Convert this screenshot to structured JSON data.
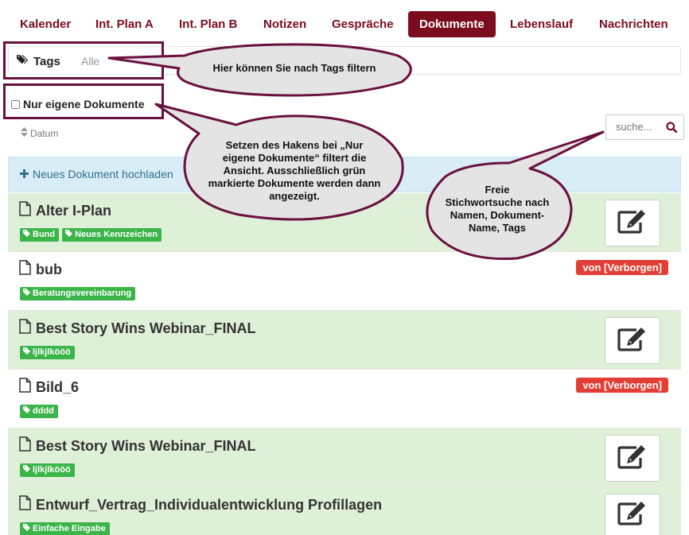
{
  "nav": {
    "items": [
      {
        "label": "Kalender"
      },
      {
        "label": "Int. Plan A"
      },
      {
        "label": "Int. Plan B"
      },
      {
        "label": "Notizen"
      },
      {
        "label": "Gespräche"
      },
      {
        "label": "Dokumente",
        "active": true
      },
      {
        "label": "Lebenslauf"
      },
      {
        "label": "Nachrichten"
      }
    ]
  },
  "filters": {
    "tags_label": "Tags",
    "tags_all": "Alle",
    "own_docs_label": "Nur eigene Dokumente",
    "own_docs_checked": false,
    "sort_label": "Datum",
    "search_placeholder": "suche..."
  },
  "upload": {
    "label": "Neues Dokument hochladen"
  },
  "documents": [
    {
      "title": "Alter I-Plan",
      "tags": [
        "Bund",
        "Neues Kennzeichen"
      ],
      "editable": true
    },
    {
      "title": "bub",
      "tags": [
        "Beratungsvereinbarung"
      ],
      "badge": "von [Verborgen]"
    },
    {
      "title": "Best Story Wins Webinar_FINAL",
      "tags": [
        "ljlkjlkööö"
      ],
      "editable": true
    },
    {
      "title": "Bild_6",
      "tags": [
        "dddd"
      ],
      "badge": "von [Verborgen]"
    },
    {
      "title": "Best Story Wins Webinar_FINAL",
      "tags": [
        "ljlkjlkööö"
      ],
      "editable": true
    },
    {
      "title": "Entwurf_Vertrag_Individualentwicklung Profillagen",
      "tags": [
        "Einfache Eingabe"
      ],
      "editable": true
    }
  ],
  "callouts": {
    "tags": "Hier können Sie nach Tags filtern",
    "own_docs": [
      "Setzen des Hakens bei „Nur",
      "eigene Dokumente“ filtert die",
      "Ansicht. Ausschließlich grün",
      "markierte Dokumente werden dann",
      "angezeigt."
    ],
    "search": [
      "Freie",
      "Stichwortsuche nach",
      "Namen, Dokument-",
      "Name, Tags"
    ]
  },
  "colors": {
    "brand": "#7a0c1e",
    "row_green": "#dff0d8",
    "tag_green": "#3bb54a",
    "badge_red": "#e33e35",
    "upload_bg": "#d9edf7",
    "annotation": "#6a1040",
    "callout_fill": "#e4e4e4"
  },
  "icons": {
    "tags": "tags-icon",
    "tag": "tag-icon",
    "search": "search-icon",
    "sort": "sort-icon",
    "upload": "plus-icon",
    "document": "file-icon",
    "edit": "edit-icon"
  }
}
